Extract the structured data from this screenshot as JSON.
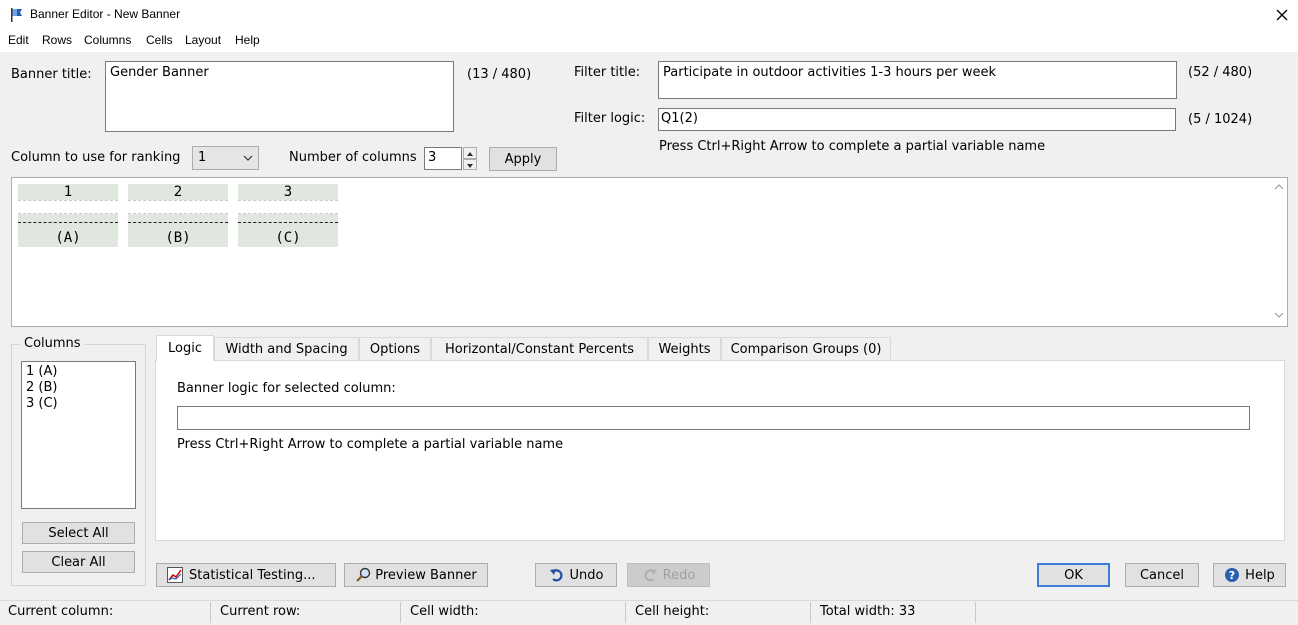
{
  "window": {
    "title": "Banner Editor - New Banner"
  },
  "menu": [
    "Edit",
    "Rows",
    "Columns",
    "Cells",
    "Layout",
    "Help"
  ],
  "banner_title": {
    "label": "Banner title:",
    "value": "Gender Banner",
    "count": "(13 / 480)"
  },
  "filter_title": {
    "label": "Filter title:",
    "value": "Participate in outdoor activities 1-3 hours per week",
    "count": "(52 / 480)"
  },
  "filter_logic": {
    "label": "Filter logic:",
    "value": "Q1(2)",
    "count": "(5 / 1024)",
    "hint": "Press Ctrl+Right Arrow to complete a partial variable name"
  },
  "ranking": {
    "label": "Column to use for ranking",
    "value": "1"
  },
  "num_columns": {
    "label": "Number of columns",
    "value": "3",
    "apply": "Apply"
  },
  "preview_columns": [
    {
      "num": "1",
      "letter": "(A)"
    },
    {
      "num": "2",
      "letter": "(B)"
    },
    {
      "num": "3",
      "letter": "(C)"
    }
  ],
  "columns_group": {
    "title": "Columns",
    "items": [
      "1 (A)",
      "2 (B)",
      "3 (C)"
    ],
    "select_all": "Select All",
    "clear_all": "Clear All"
  },
  "tabs": [
    "Logic",
    "Width and Spacing",
    "Options",
    "Horizontal/Constant Percents",
    "Weights",
    "Comparison Groups (0)"
  ],
  "logic_tab": {
    "label": "Banner logic for selected column:",
    "value": "",
    "hint": "Press Ctrl+Right Arrow to complete a partial variable name"
  },
  "buttons": {
    "statistical_testing": "Statistical Testing...",
    "preview_banner": "Preview Banner",
    "undo": "Undo",
    "redo": "Redo",
    "ok": "OK",
    "cancel": "Cancel",
    "help": "Help"
  },
  "status": {
    "current_column": "Current column:",
    "current_row": "Current row:",
    "cell_width": "Cell width:",
    "cell_height": "Cell height:",
    "total_width": "Total width: 33"
  },
  "colors": {
    "accent": "#3b7dd8",
    "column_fill": "#dfe7df"
  }
}
